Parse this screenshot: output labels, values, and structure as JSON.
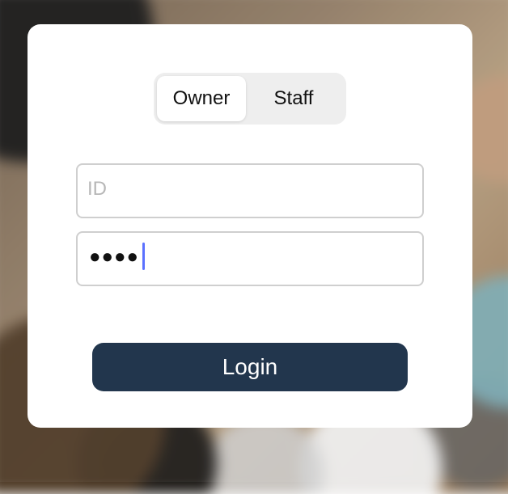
{
  "login": {
    "segments": {
      "owner": "Owner",
      "staff": "Staff"
    },
    "fields": {
      "id_placeholder": "ID",
      "password_value": "●●●●"
    },
    "button": {
      "label": "Login"
    }
  },
  "colors": {
    "card_background": "#ffffff",
    "segmented_background": "#eeeeee",
    "button_background": "#22364d",
    "button_text": "#ffffff",
    "cursor": "#5b71ff"
  }
}
